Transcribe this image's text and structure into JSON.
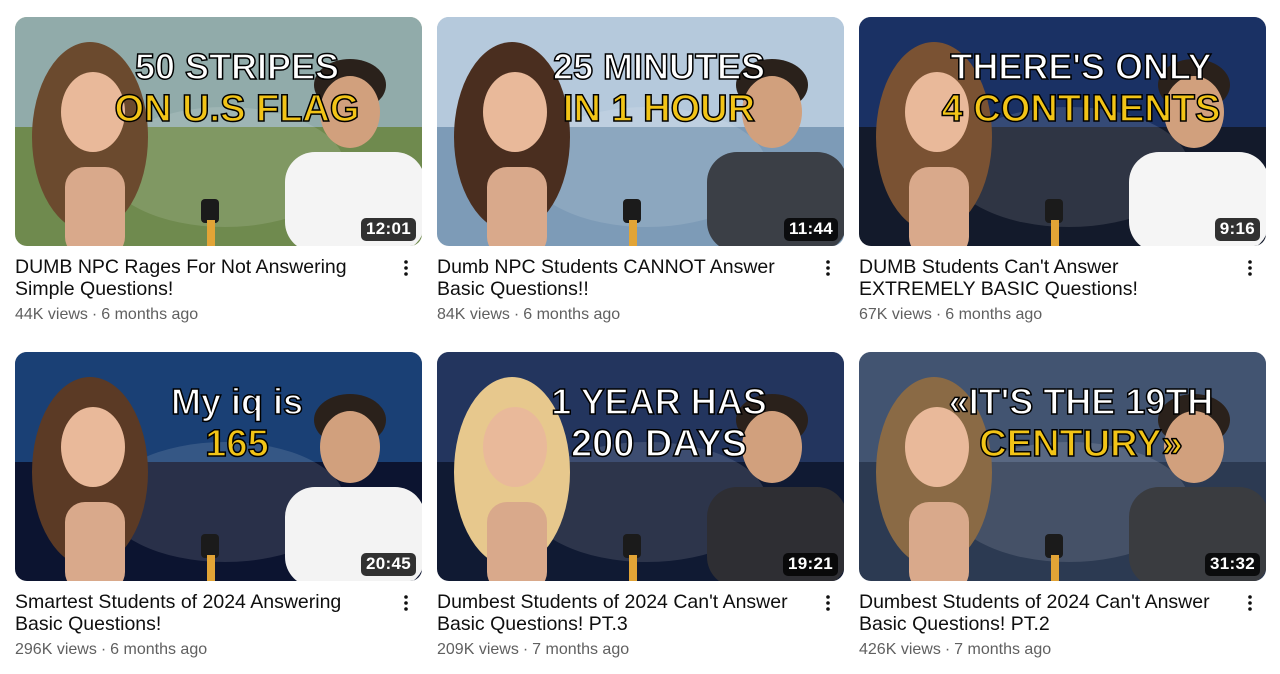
{
  "videos": [
    {
      "title": "DUMB NPC Rages For Not Answering Simple Questions!",
      "views": "44K views",
      "age": "6 months ago",
      "duration": "12:01",
      "thumb_text": [
        "50 STRIPES",
        "ON U.S FLAG"
      ],
      "colors": {
        "bg": "#6f8a4e",
        "sky": "#9cb6c9",
        "text1": "#ffffff",
        "text2": "#f2c417",
        "shirt": "#f4f4f4",
        "hair": "#6b4a2e"
      }
    },
    {
      "title": "Dumb NPC Students CANNOT Answer Basic Questions!!",
      "views": "84K views",
      "age": "6 months ago",
      "duration": "11:44",
      "thumb_text": [
        "25 MINUTES",
        "IN 1 HOUR"
      ],
      "colors": {
        "bg": "#7d9bb7",
        "sky": "#c8d8e8",
        "text1": "#ffffff",
        "text2": "#f2c417",
        "shirt": "#3b3f46",
        "hair": "#4a2e1f"
      }
    },
    {
      "title": "DUMB Students Can't Answer EXTREMELY BASIC Questions!",
      "views": "67K views",
      "age": "6 months ago",
      "duration": "9:16",
      "thumb_text": [
        "THERE'S ONLY",
        "4 CONTINENTS"
      ],
      "colors": {
        "bg": "#131a2b",
        "sky": "#1e3a78",
        "text1": "#ffffff",
        "text2": "#f2c417",
        "shirt": "#f5f5f5",
        "hair": "#7a5233"
      }
    },
    {
      "title": "Smartest Students of 2024 Answering Basic Questions!",
      "views": "296K views",
      "age": "6 months ago",
      "duration": "20:45",
      "thumb_text": [
        "My iq is",
        "165"
      ],
      "colors": {
        "bg": "#0c1430",
        "sky": "#1f4f8c",
        "text1": "#ffffff",
        "text2": "#f2c417",
        "shirt": "#f3f3f3",
        "hair": "#5b3a25"
      }
    },
    {
      "title": "Dumbest Students of 2024 Can't Answer Basic Questions! PT.3",
      "views": "209K views",
      "age": "7 months ago",
      "duration": "19:21",
      "thumb_text": [
        "1 YEAR HAS",
        "200 DAYS"
      ],
      "colors": {
        "bg": "#101a33",
        "sky": "#2a3f6e",
        "text1": "#ffffff",
        "text2": "#ffffff",
        "shirt": "#2e2e33",
        "hair": "#e7c88d"
      }
    },
    {
      "title": "Dumbest Students of 2024 Can't Answer Basic Questions! PT.2",
      "views": "426K views",
      "age": "7 months ago",
      "duration": "31:32",
      "thumb_text": [
        "«IT'S THE 19TH",
        "CENTURY»"
      ],
      "colors": {
        "bg": "#2c3a52",
        "sky": "#495e7c",
        "text1": "#ffffff",
        "text2": "#f2c417",
        "shirt": "#3a3c40",
        "hair": "#8a6a45"
      }
    }
  ],
  "ui": {
    "more_icon": "vertical-ellipsis-icon",
    "separator": "·"
  }
}
